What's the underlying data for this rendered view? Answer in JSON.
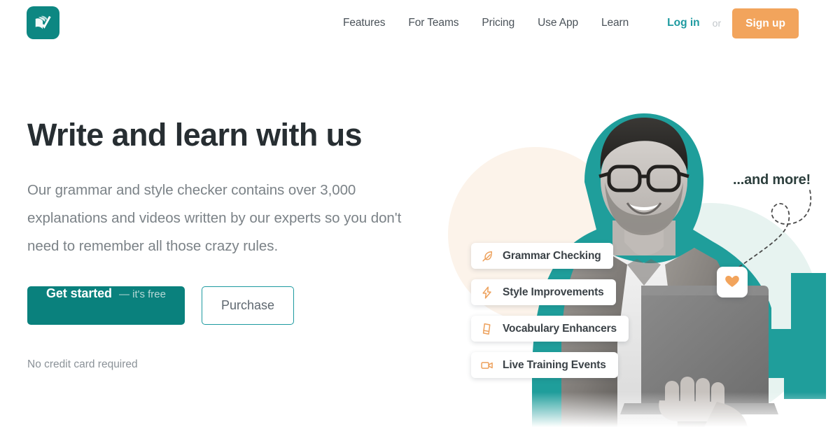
{
  "brand": {
    "logo_icon": "book-check-logo-icon",
    "teal": "#0d8782",
    "orange": "#f2a45c",
    "link_teal": "#1d9aa0",
    "headline_color": "#272e32"
  },
  "nav": {
    "items": [
      {
        "label": "Features",
        "name": "nav-item-features"
      },
      {
        "label": "For Teams",
        "name": "nav-item-for-teams"
      },
      {
        "label": "Pricing",
        "name": "nav-item-pricing"
      },
      {
        "label": "Use App",
        "name": "nav-item-use-app"
      },
      {
        "label": "Learn",
        "name": "nav-item-learn"
      }
    ],
    "login_label": "Log in",
    "separator": "or",
    "signup_label": "Sign up"
  },
  "hero": {
    "headline": "Write and learn with us",
    "subcopy": "Our grammar and style checker contains over 3,000 explanations and videos written by our experts so you don't need to remember all those crazy rules.",
    "primary_cta_main": "Get started",
    "primary_cta_sub": "— it's free",
    "secondary_cta": "Purchase",
    "fineprint": "No credit card required"
  },
  "features": {
    "pills": [
      {
        "label": "Grammar Checking",
        "icon": "feather-icon"
      },
      {
        "label": "Style Improvements",
        "icon": "lightning-bolt-icon"
      },
      {
        "label": "Vocabulary Enhancers",
        "icon": "book-icon"
      },
      {
        "label": "Live Training Events",
        "icon": "video-camera-icon"
      }
    ],
    "annotation": "...and more!",
    "annotation_icon": "heart-icon"
  }
}
